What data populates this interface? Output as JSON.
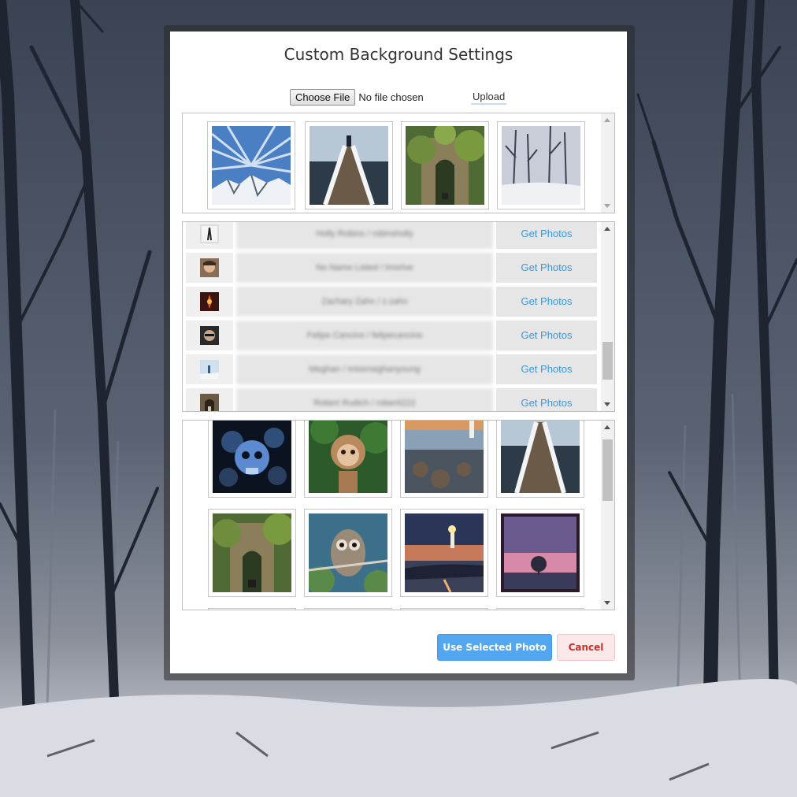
{
  "modal": {
    "title": "Custom Background Settings",
    "choose_file_label": "Choose File",
    "file_status": "No file chosen",
    "upload_label": "Upload",
    "primary_button": "Use Selected Photo",
    "cancel_button": "Cancel"
  },
  "recent_photos": [
    {
      "icon": "sky-mountain-photo"
    },
    {
      "icon": "pier-photo"
    },
    {
      "icon": "ruins-gate-photo"
    },
    {
      "icon": "snow-forest-photo"
    }
  ],
  "users": [
    {
      "name": "Holly Robins / robinsholly",
      "action": "Get Photos"
    },
    {
      "name": "No Name Listed / lmorive",
      "action": "Get Photos"
    },
    {
      "name": "Zachary Zahn / z.zahn",
      "action": "Get Photos"
    },
    {
      "name": "Felipe Cancino / felipecancino",
      "action": "Get Photos"
    },
    {
      "name": "Meghan / missmeghanyoung",
      "action": "Get Photos"
    },
    {
      "name": "Robert Rudich / rober6222",
      "action": "Get Photos"
    }
  ],
  "gallery_photos": [
    {
      "icon": "skulls-photo"
    },
    {
      "icon": "monkey-photo"
    },
    {
      "icon": "lighthouse-rocks-photo"
    },
    {
      "icon": "pier-photo"
    },
    {
      "icon": "ruins-gate-photo"
    },
    {
      "icon": "owl-photo"
    },
    {
      "icon": "lighthouse-sunset-photo"
    },
    {
      "icon": "pink-sky-tree-photo"
    }
  ],
  "colors": {
    "primary": "#52a7f0",
    "link": "#3a97d9",
    "cancel_text": "#c9302c"
  }
}
